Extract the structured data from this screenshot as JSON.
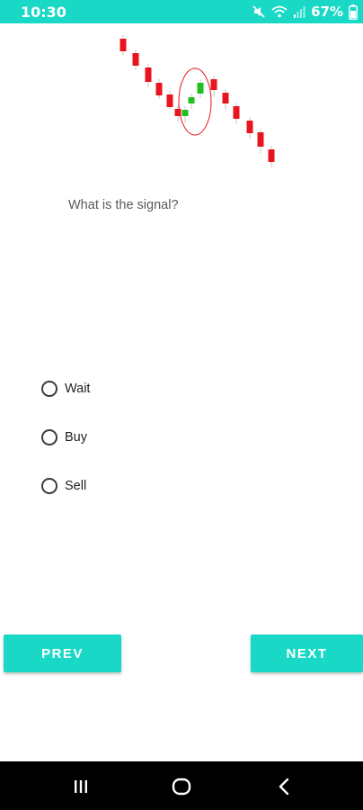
{
  "status_bar": {
    "time": "10:30",
    "battery": "67%",
    "icons": [
      "mute-icon",
      "wifi-icon",
      "signal-icon",
      "battery-icon"
    ]
  },
  "chart_data": {
    "type": "candlestick",
    "title": "",
    "candles": [
      {
        "color": "red"
      },
      {
        "color": "red"
      },
      {
        "color": "red"
      },
      {
        "color": "red"
      },
      {
        "color": "red"
      },
      {
        "color": "red"
      },
      {
        "color": "green"
      },
      {
        "color": "green"
      },
      {
        "color": "green"
      },
      {
        "color": "red"
      },
      {
        "color": "red"
      },
      {
        "color": "red"
      },
      {
        "color": "red"
      },
      {
        "color": "red"
      },
      {
        "color": "red"
      }
    ],
    "highlight": "red ellipse around green candles",
    "colors": {
      "bull": "#1fbf1f",
      "bear": "#e8141e",
      "highlight": "#e8141e"
    }
  },
  "question": {
    "text": "What is the signal?"
  },
  "options": [
    {
      "label": "Wait",
      "selected": false
    },
    {
      "label": "Buy",
      "selected": false
    },
    {
      "label": "Sell",
      "selected": false
    }
  ],
  "buttons": {
    "prev_label": "PREV",
    "next_label": "NEXT"
  },
  "colors": {
    "accent": "#19d8c5"
  },
  "nav_bar": {
    "icons": [
      "recents-icon",
      "home-icon",
      "back-icon"
    ]
  }
}
